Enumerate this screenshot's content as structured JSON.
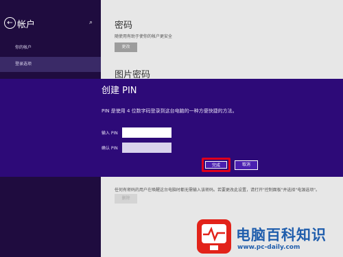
{
  "sidebar": {
    "title": "帐户",
    "items": [
      {
        "label": "你的帐户"
      },
      {
        "label": "登录选项"
      }
    ]
  },
  "settings": {
    "password_title": "密码",
    "password_desc": "随使用有助于使你的帐户更安全",
    "change_label": "更改",
    "picture_password_title": "图片密码",
    "pin_desc": "任何有密码的用户在唤醒这台电脑时都无需输入该密码。若要更改此设置，请打开\"控制面板\"并选择\"电源选项\"。",
    "remove_label": "删除"
  },
  "dialog": {
    "title": "创建 PIN",
    "description": "PIN 是使用 4 位数字码登录到这台电脑的一种方便快捷的方法。",
    "pin_label": "输入 PIN",
    "confirm_label": "确认 PIN",
    "pin_value": "",
    "confirm_value": "",
    "finish_label": "完成",
    "cancel_label": "取消"
  },
  "watermark": {
    "title": "电脑百科知识",
    "url": "www.pc-daily.com"
  },
  "colors": {
    "sidebar": "#1f0c3f",
    "dialog": "#2d0a78",
    "highlight": "#e0001a",
    "watermark": "#1f5dac"
  }
}
